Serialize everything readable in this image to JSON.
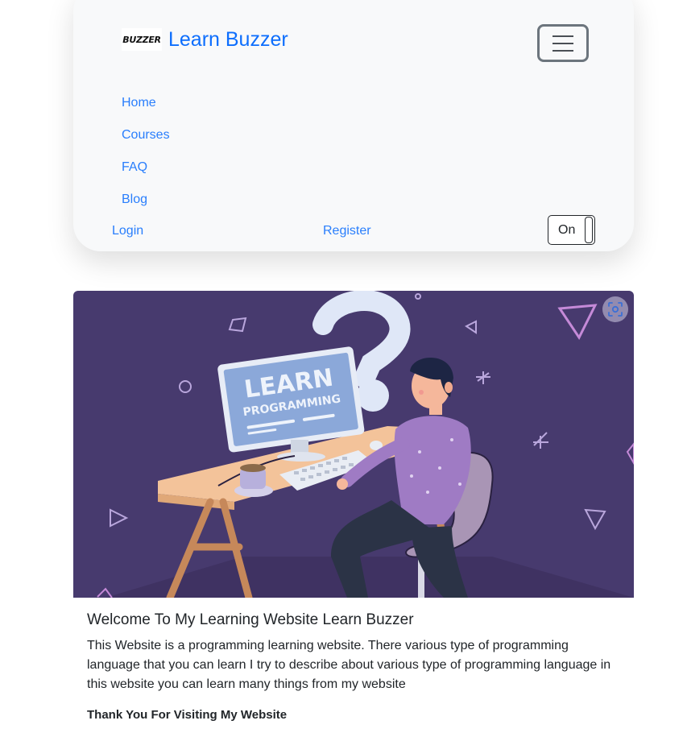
{
  "navbar": {
    "brand_logo_text": "BUZZER",
    "brand_name": "Learn Buzzer",
    "menu_toggle_icon": "hamburger-icon",
    "links": [
      "Home",
      "Courses",
      "FAQ",
      "Blog"
    ],
    "login": "Login",
    "register": "Register",
    "toggle_label": "On"
  },
  "hero": {
    "screen_line1": "LEARN",
    "screen_line2": "PROGRAMMING",
    "lens_icon": "visual-search-icon",
    "colors": {
      "background": "#473a6e",
      "screen": "#8ba8d9",
      "desk": "#f3c39a",
      "shirt": "#9f7bc4"
    }
  },
  "card": {
    "title": "Welcome To My Learning Website Learn Buzzer",
    "text": "This Website is a programming learning website. There various type of programming language that you can learn I try to describe about various type of programming language in this website you can learn many things from my website",
    "footer": "Thank You For Visiting My Website"
  },
  "colors": {
    "link": "#0d6efd",
    "nav_background": "#f8f9fa"
  }
}
